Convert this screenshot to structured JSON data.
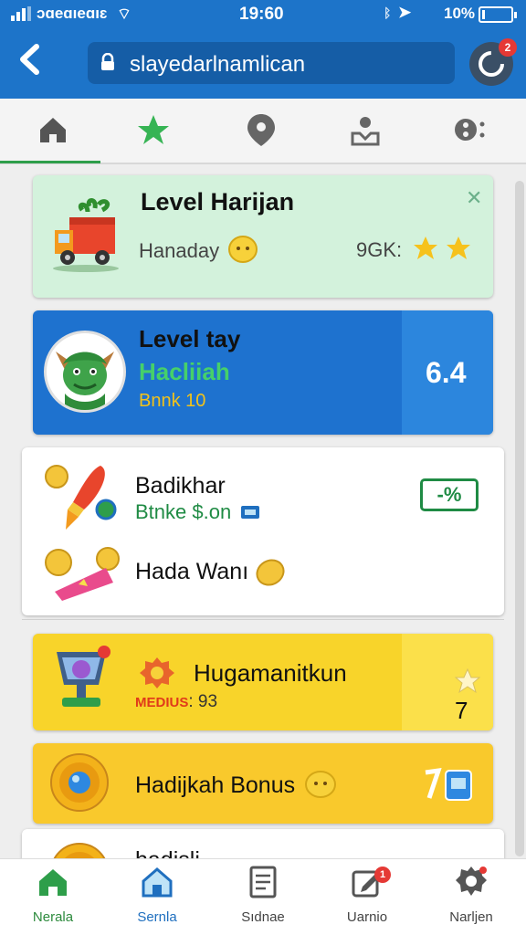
{
  "status_bar": {
    "carrier": "ɔɑeɑıeɑıɛ",
    "time": "19:60",
    "battery_text": "10%",
    "battery_level": 0.1
  },
  "header": {
    "back_icon": "chevron-left-icon",
    "url": "slayedarlnamlican",
    "notification_badge": "2"
  },
  "tabs": [
    {
      "icon": "home-icon"
    },
    {
      "icon": "star-icon"
    },
    {
      "icon": "map-pin-icon"
    },
    {
      "icon": "user-upload-icon"
    },
    {
      "icon": "more-icon"
    }
  ],
  "cards": {
    "daily_level": {
      "title": "Level Harijan",
      "subtitle": "Hanaday",
      "value": "9GK:",
      "close_icon": "close-icon"
    },
    "level_tay": {
      "title": "Level tay",
      "subtitle": "Hacliiah",
      "small": "Bnnk 10",
      "score": "6.4"
    },
    "rewards_list": {
      "item1_title": "Badikhar",
      "item1_subtitle": "Btnke $.on",
      "item1_badge": "-%",
      "item2_title": "Hada Wanı"
    },
    "quest": {
      "title": "Hugamanitkun",
      "small_label": "MEDIUS",
      "small_value": ": 93",
      "count": "7"
    },
    "bonus": {
      "title": "Hadijkah Bonus"
    },
    "partial": {
      "title": "hadisli"
    }
  },
  "bottom_nav": [
    {
      "label": "Nerala",
      "icon": "home-icon"
    },
    {
      "label": "Sernla",
      "icon": "house-icon"
    },
    {
      "label": "Sıdnae",
      "icon": "document-icon"
    },
    {
      "label": "Uarnio",
      "icon": "edit-icon",
      "badge": "1"
    },
    {
      "label": "Narljen",
      "icon": "settings-icon"
    }
  ],
  "colors": {
    "header": "#1d74c9",
    "card_green": "#d3f2dc",
    "card_blue": "#1e72cf",
    "card_yellow": "#f8d42a",
    "active_green": "#2e8b3e"
  }
}
